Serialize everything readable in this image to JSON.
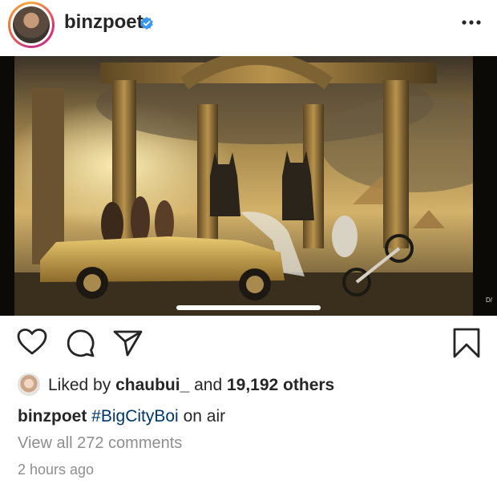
{
  "post": {
    "username": "binzpoet",
    "verified": true,
    "media_corner_text": "D/"
  },
  "likes": {
    "prefix": "Liked by",
    "liker": "chaubui_",
    "middle": "and",
    "count": "19,192 others"
  },
  "caption": {
    "username": "binzpoet",
    "hashtag": "#BigCityBoi",
    "text": "on air"
  },
  "comments_link": "View all 272 comments",
  "timestamp": "2 hours ago",
  "icons": {
    "more": "more-options-icon",
    "like": "heart-icon",
    "comment": "comment-bubble-icon",
    "share": "paper-plane-icon",
    "save": "bookmark-icon",
    "verified": "verified-badge-icon"
  },
  "colors": {
    "text": "#262626",
    "secondary": "#8e8e8e",
    "hashtag": "#00376b",
    "verified": "#3897f0"
  }
}
